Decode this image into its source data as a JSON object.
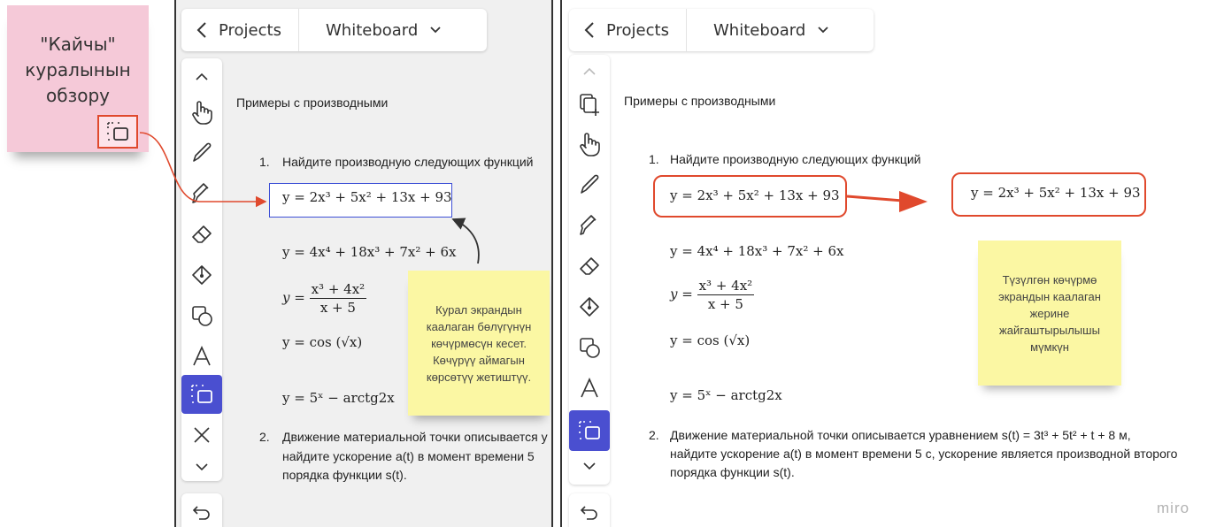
{
  "callout": {
    "lines": [
      "\"Кайчы\"",
      "куралынын",
      "обзору"
    ],
    "icon": "scissors-tool-icon",
    "colors": {
      "sticky": "#f5c9d8",
      "border": "#e0492d"
    }
  },
  "topbar": {
    "back_icon": "chevron-left-icon",
    "projects_label": "Projects",
    "board_label": "Whiteboard",
    "dropdown_icon": "chevron-down-icon"
  },
  "toolbar": {
    "left": [
      "chevron-up-icon",
      "hand-icon",
      "pen-icon",
      "marker-icon",
      "eraser-icon",
      "fill-icon",
      "shapes-icon",
      "text-icon",
      "scissors-tool-icon",
      "close-icon",
      "chevron-down-icon"
    ],
    "right": [
      "chevron-up-icon",
      "copy-add-icon",
      "hand-icon",
      "pen-icon",
      "marker-icon",
      "eraser-icon",
      "fill-icon",
      "shapes-icon",
      "text-icon",
      "scissors-tool-icon",
      "chevron-down-icon"
    ],
    "undo_icon": "undo-icon",
    "active_color": "#4a4fd0"
  },
  "board": {
    "heading": "Примеры с производными",
    "item1_num": "1.",
    "item1_text": "Найдите производную следующих функций",
    "formula1": "y = 2x³ + 5x² + 13x + 93",
    "formula2": "y = 4x⁴ + 18x³ + 7x² + 6x",
    "formula3_num": "x³ + 4x²",
    "formula3_den": "x + 5",
    "formula4": "y = cos (√x)",
    "formula5": "y = 5ˣ − arctg2x",
    "item2_num": "2.",
    "item2_left_line1": "Движение материальной точки описывается у",
    "item2_left_line2": "найдите ускорение a(t) в момент времени 5",
    "item2_left_line3": "порядка функции s(t).",
    "item2_right_line1": "Движение материальной точки описывается уравнением s(t) = 3t³ + 5t² + t + 8 м,",
    "item2_right_line2": "найдите ускорение a(t) в момент времени 5 с, ускорение является производной второго",
    "item2_right_line3": "порядка функции s(t)."
  },
  "notes": {
    "left": "Курал экрандын каалаган бөлүгүнүн көчүрмөсүн кесет. Көчүрүү аймагын көрсөтүү жетиштүү.",
    "right": "Түзүлгөн көчүрмө экрандын каалаган жерине жайгаштырылышы мүмкүн",
    "color": "#fbf7a3"
  },
  "watermark": "miro",
  "colors": {
    "selection": "#3d4fd6",
    "arrow": "#e0492d"
  }
}
